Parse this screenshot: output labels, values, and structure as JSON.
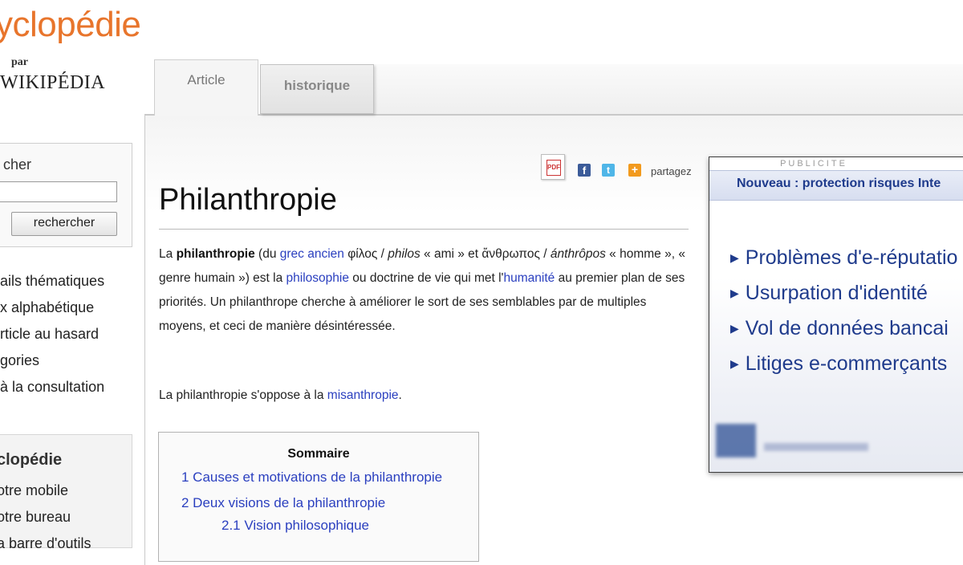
{
  "logo": {
    "title": "yclopédie",
    "par": "par",
    "wikipedia": "WIKIPÉDIA"
  },
  "tabs": {
    "article": "Article",
    "historique": "historique"
  },
  "sidebar": {
    "search_label": "cher",
    "search_placeholder": "",
    "search_button": "rechercher",
    "nav": [
      "ails thématiques",
      "x alphabétique",
      "rticle au hasard",
      "gories",
      "à la consultation"
    ],
    "section_title": "clopédie",
    "section_items": [
      "otre mobile",
      "otre bureau",
      "a barre d'outils"
    ]
  },
  "share": {
    "pdf_label": "PDF",
    "label": "partagez"
  },
  "article": {
    "title": "Philanthropie",
    "p1": {
      "t1": "La ",
      "b1": "philanthropie",
      "t2": " (du ",
      "l1": "grec ancien",
      "t3": " φίλος / ",
      "i1": "philos",
      "t4": " « ami » et ἄνθρωπος / ",
      "i2": "ánthrôpos",
      "t5": " « homme », « genre humain ») est la ",
      "l2": "philosophie",
      "t6": " ou doctrine de vie qui met l'",
      "l3": "humanité",
      "t7": " au premier plan de ses priorités. Un philanthrope cherche à améliorer le sort de ses semblables par de multiples moyens, et ceci de manière désintéressée."
    },
    "p2": {
      "t1": "La philanthropie s'oppose à la ",
      "l1": "misanthropie",
      "t2": "."
    }
  },
  "toc": {
    "title": "Sommaire",
    "items": [
      "1 Causes et motivations de la philanthropie",
      "2 Deux visions de la philanthropie",
      "2.1 Vision philosophique"
    ]
  },
  "ad": {
    "label": "PUBLICITE",
    "header": "Nouveau :  protection risques Inte",
    "items": [
      "Problèmes d'e-réputatio",
      "Usurpation d'identité",
      "Vol de données bancai",
      "Litiges e-commerçants"
    ]
  },
  "colors": {
    "logo_orange": "#e8752c",
    "link_blue": "#2a3fbf",
    "ad_blue": "#1f3b8c"
  }
}
